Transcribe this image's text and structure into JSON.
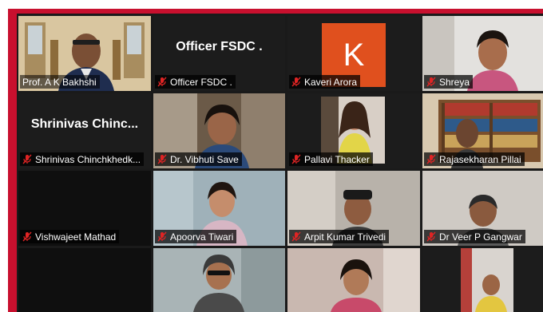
{
  "meeting": {
    "participants": [
      {
        "name": "Prof. A K Bakhshi",
        "muted": false,
        "active": true,
        "video": true
      },
      {
        "name": "Officer FSDC .",
        "muted": true,
        "video": false,
        "display_name": "Officer FSDC ."
      },
      {
        "name": "Kaveri Arora",
        "muted": true,
        "video": false,
        "avatar_letter": "K",
        "avatar_color": "#e0501e"
      },
      {
        "name": "Shreya",
        "muted": true,
        "video": true
      },
      {
        "name": "Shrinivas Chinchkhedk...",
        "muted": true,
        "video": false,
        "display_name": "Shrinivas  Chinc..."
      },
      {
        "name": "Dr. Vibhuti Save",
        "muted": true,
        "video": true
      },
      {
        "name": "Pallavi Thacker",
        "muted": true,
        "video": true
      },
      {
        "name": "Rajasekharan Pillai",
        "muted": true,
        "video": true
      },
      {
        "name": "Vishwajeet Mathad",
        "muted": true,
        "video": false
      },
      {
        "name": "Apoorva Tiwari",
        "muted": true,
        "video": true
      },
      {
        "name": "Arpit Kumar Trivedi",
        "muted": true,
        "video": true
      },
      {
        "name": "Dr Veer P Gangwar",
        "muted": true,
        "video": true
      },
      {
        "name": "",
        "muted": true,
        "video": false
      },
      {
        "name": "",
        "muted": true,
        "video": true
      },
      {
        "name": "",
        "muted": true,
        "video": true
      },
      {
        "name": "",
        "muted": true,
        "video": true
      }
    ]
  },
  "colors": {
    "frame_accent": "#c8102e",
    "active_speaker": "#e5e53a",
    "muted_mic": "#e02424"
  },
  "icons": {
    "muted": "mic-muted-icon"
  }
}
